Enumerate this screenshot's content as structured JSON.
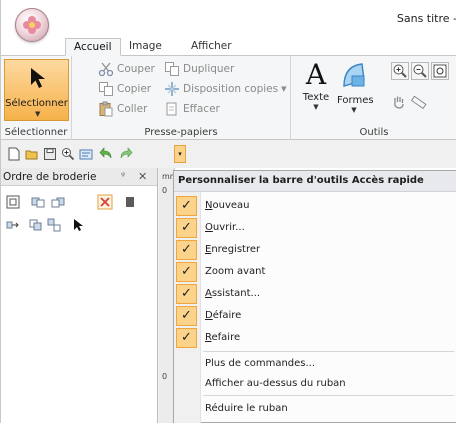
{
  "window": {
    "title": "Sans titre -"
  },
  "ribbon_tabs": [
    "Accueil",
    "Image",
    "Afficher"
  ],
  "ribbon": {
    "select": {
      "label": "Sélectionner",
      "group": "Sélectionner"
    },
    "clipboard": {
      "group": "Presse-papiers",
      "cut": "Couper",
      "duplicate": "Dupliquer",
      "copy": "Copier",
      "layout_copies": "Disposition copies",
      "paste": "Coller",
      "delete": "Effacer"
    },
    "tools": {
      "group": "Outils",
      "text": "Texte",
      "shapes": "Formes"
    }
  },
  "panel": {
    "title": "Ordre de broderie",
    "pin": "ᵠ",
    "close": "✕"
  },
  "ruler": {
    "top": "mm",
    "mark1": "0",
    "mark2": "0"
  },
  "qat_menu": {
    "header": "Personnaliser la barre d'outils Accès rapide",
    "checked_items": [
      {
        "first": "N",
        "rest": "ouveau"
      },
      {
        "first": "O",
        "rest": "uvrir..."
      },
      {
        "first": "E",
        "rest": "nregistrer"
      },
      {
        "first": "",
        "rest": "Zoom avant"
      },
      {
        "first": "A",
        "rest": "ssistant..."
      },
      {
        "first": "D",
        "rest": "éfaire"
      },
      {
        "first": "R",
        "rest": "efaire"
      }
    ],
    "more_commands": "Plus de commandes...",
    "show_above": "Afficher au-dessus du ruban",
    "minimize": "Réduire le ruban",
    "check_mark": "✓"
  },
  "colors": {
    "accent_orange": "#f6b24a",
    "check_bg": "#fcd38b",
    "menu_header": "#e7e9ec"
  }
}
